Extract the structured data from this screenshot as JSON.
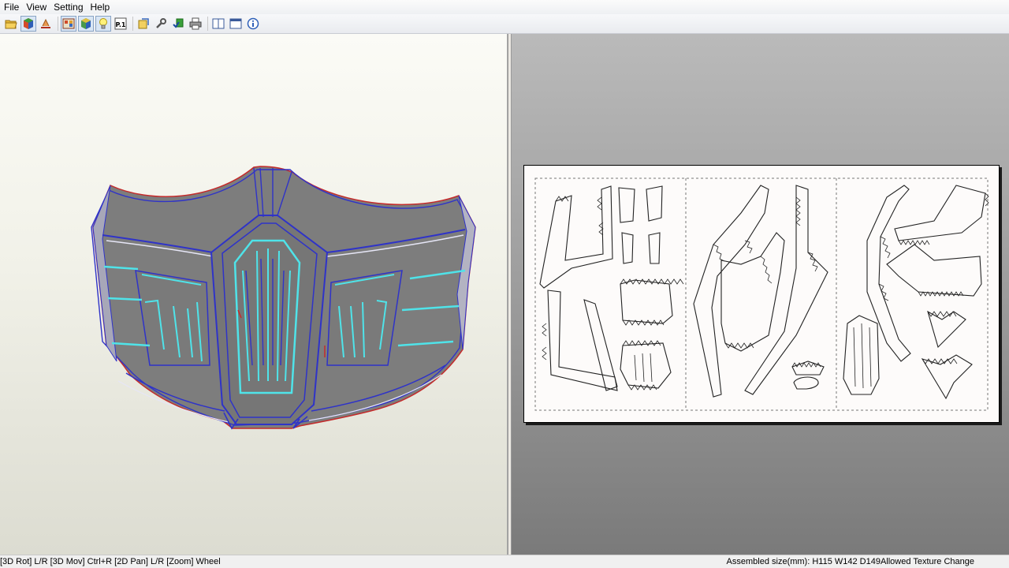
{
  "menu": {
    "items": [
      "File",
      "View",
      "Setting",
      "Help"
    ]
  },
  "toolbar": {
    "buttons": [
      "open-folder-icon",
      "3d-model-icon",
      "unfold-icon",
      "texture-icon",
      "model-view-icon",
      "light-bulb-icon",
      "page-number-icon",
      "settings-icon",
      "wrench-icon",
      "check-icon",
      "print-icon",
      "single-view-icon",
      "dual-view-icon",
      "info-icon"
    ],
    "page_label": "P.1"
  },
  "status": {
    "left": "[3D Rot] L/R [3D Mov] Ctrl+R [2D Pan] L/R [Zoom] Wheel",
    "right": "Assembled size(mm): H115 W142 D149Allowed Texture Change"
  },
  "colors": {
    "mask_fill": "#7d7d7d",
    "mask_edge_blue": "#2f33c8",
    "mask_edge_red": "#c42b2b",
    "mask_glow_cyan": "#4fe3e9"
  }
}
